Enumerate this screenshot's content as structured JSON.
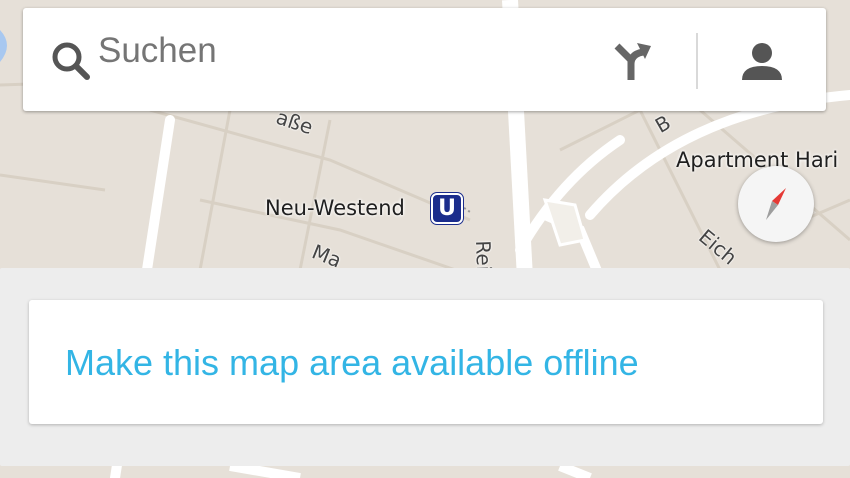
{
  "search": {
    "placeholder": "Suchen"
  },
  "map": {
    "station_label": "Neu-Westend",
    "ubahn_symbol": "U",
    "place_label": "Apartment Hari",
    "street_labels": [
      "aße",
      "Ma",
      "Reic",
      "Eich",
      "B"
    ]
  },
  "icons": {
    "search": "search-icon",
    "directions": "directions-icon",
    "account": "account-icon",
    "compass": "compass-icon"
  },
  "offline_card": {
    "link_text": "Make this map area available offline"
  },
  "colors": {
    "link": "#33b5e5",
    "ubahn_badge": "#1b2d8c",
    "compass_needle": "#e53935"
  }
}
